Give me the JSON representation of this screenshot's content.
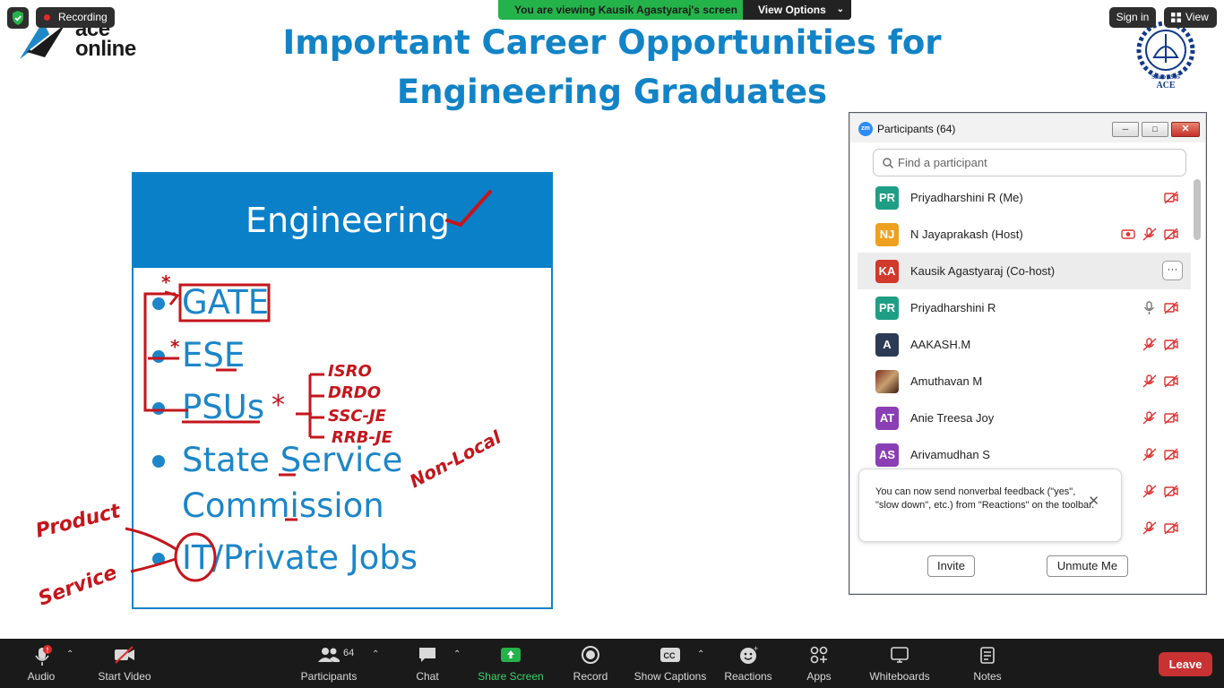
{
  "overlay": {
    "recording_label": "Recording",
    "viewing_text": "You are viewing Kausik Agastyaraj's screen",
    "view_options_label": "View Options",
    "sign_in_label": "Sign in",
    "view_label": "View"
  },
  "branding": {
    "ace_online_line1": "ace",
    "ace_online_line2": "online",
    "seal_year": "Since 1995",
    "seal_abbr": "ACE"
  },
  "slide": {
    "title_line1": "Important Career Opportunities for",
    "title_line2": "Engineering Graduates",
    "card_heading": "Engineering",
    "bullets": [
      "GATE",
      "ESE",
      "PSUs",
      "State Service",
      "Commission",
      "IT/Private Jobs"
    ],
    "annotations": {
      "psu_star": "*",
      "psu_list": [
        "ISRO",
        "DRDO",
        "SSC-JE",
        "RRB-JE"
      ],
      "non_local": "Non-Local",
      "product": "Product",
      "service": "Service"
    }
  },
  "participants": {
    "title": "Participants (64)",
    "search_placeholder": "Find a participant",
    "rows": [
      {
        "initials": "PR",
        "name": "Priyadharshini R (Me)",
        "color": "#1e9e85"
      },
      {
        "initials": "NJ",
        "name": "N Jayaprakash (Host)",
        "color": "#f0a020"
      },
      {
        "initials": "KA",
        "name": "Kausik Agastyaraj (Co-host)",
        "color": "#d0392b",
        "more": "···"
      },
      {
        "initials": "PR",
        "name": "Priyadharshini R",
        "color": "#1e9e85"
      },
      {
        "initials": "A",
        "name": "AAKASH.M",
        "color": "#2b3a55"
      },
      {
        "initials": "",
        "name": "Amuthavan M",
        "color": "#7a2b1f"
      },
      {
        "initials": "AT",
        "name": "Anie Treesa Joy",
        "color": "#8a3fb5"
      },
      {
        "initials": "AS",
        "name": "Arivamudhan S",
        "color": "#8a3fb5"
      }
    ],
    "tooltip_text": "You can now send nonverbal feedback (\"yes\", \"slow down\", etc.) from \"Reactions\" on the toolbar.",
    "invite_label": "Invite",
    "unmute_label": "Unmute Me"
  },
  "toolbar": {
    "audio": "Audio",
    "start_video": "Start Video",
    "participants_count": "64",
    "participants": "Participants",
    "chat": "Chat",
    "share_screen": "Share Screen",
    "record": "Record",
    "show_captions": "Show Captions",
    "reactions": "Reactions",
    "apps": "Apps",
    "whiteboards": "Whiteboards",
    "notes": "Notes",
    "leave": "Leave"
  },
  "colors": {
    "accent_blue": "#1283c6",
    "share_green": "#24b34a",
    "leave_red": "#c83232",
    "ink_red": "#c4161c"
  }
}
